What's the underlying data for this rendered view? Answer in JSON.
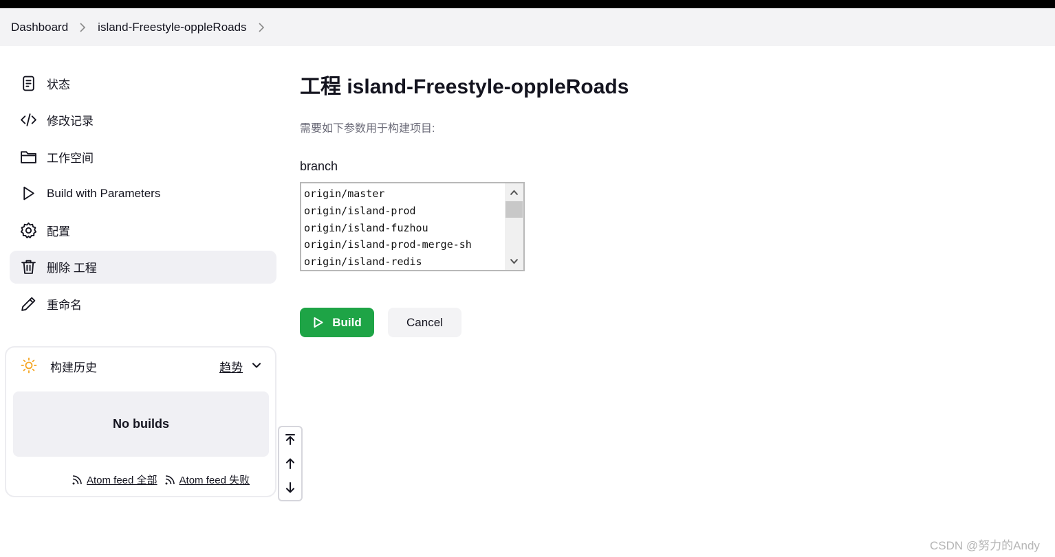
{
  "breadcrumbs": [
    {
      "label": "Dashboard"
    },
    {
      "label": "island-Freestyle-oppleRoads"
    }
  ],
  "sidebar": {
    "items": [
      {
        "label": "状态",
        "icon": "document-icon"
      },
      {
        "label": "修改记录",
        "icon": "code-icon"
      },
      {
        "label": "工作空间",
        "icon": "folder-icon"
      },
      {
        "label": "Build with Parameters",
        "icon": "play-icon"
      },
      {
        "label": "配置",
        "icon": "gear-icon"
      },
      {
        "label": "删除 工程",
        "icon": "trash-icon",
        "active": true
      },
      {
        "label": "重命名",
        "icon": "pencil-icon"
      }
    ]
  },
  "build_history": {
    "title": "构建历史",
    "trend_label": "趋势",
    "empty_text": "No builds",
    "feeds": {
      "all_label": "Atom feed 全部",
      "failed_label": "Atom feed 失败"
    }
  },
  "main": {
    "title": "工程 island-Freestyle-oppleRoads",
    "description": "需要如下参数用于构建项目:",
    "parameter": {
      "name": "branch",
      "options": [
        "origin/master",
        "origin/island-prod",
        "origin/island-fuzhou",
        "origin/island-prod-merge-sh",
        "origin/island-redis"
      ]
    },
    "build_label": "Build",
    "cancel_label": "Cancel"
  },
  "watermark": "CSDN @努力的Andy",
  "colors": {
    "primary_green": "#1ea446",
    "breadcrumb_bg": "#f3f3f5",
    "active_item_bg": "#f0f0f4",
    "sun_icon": "#f5a623"
  }
}
